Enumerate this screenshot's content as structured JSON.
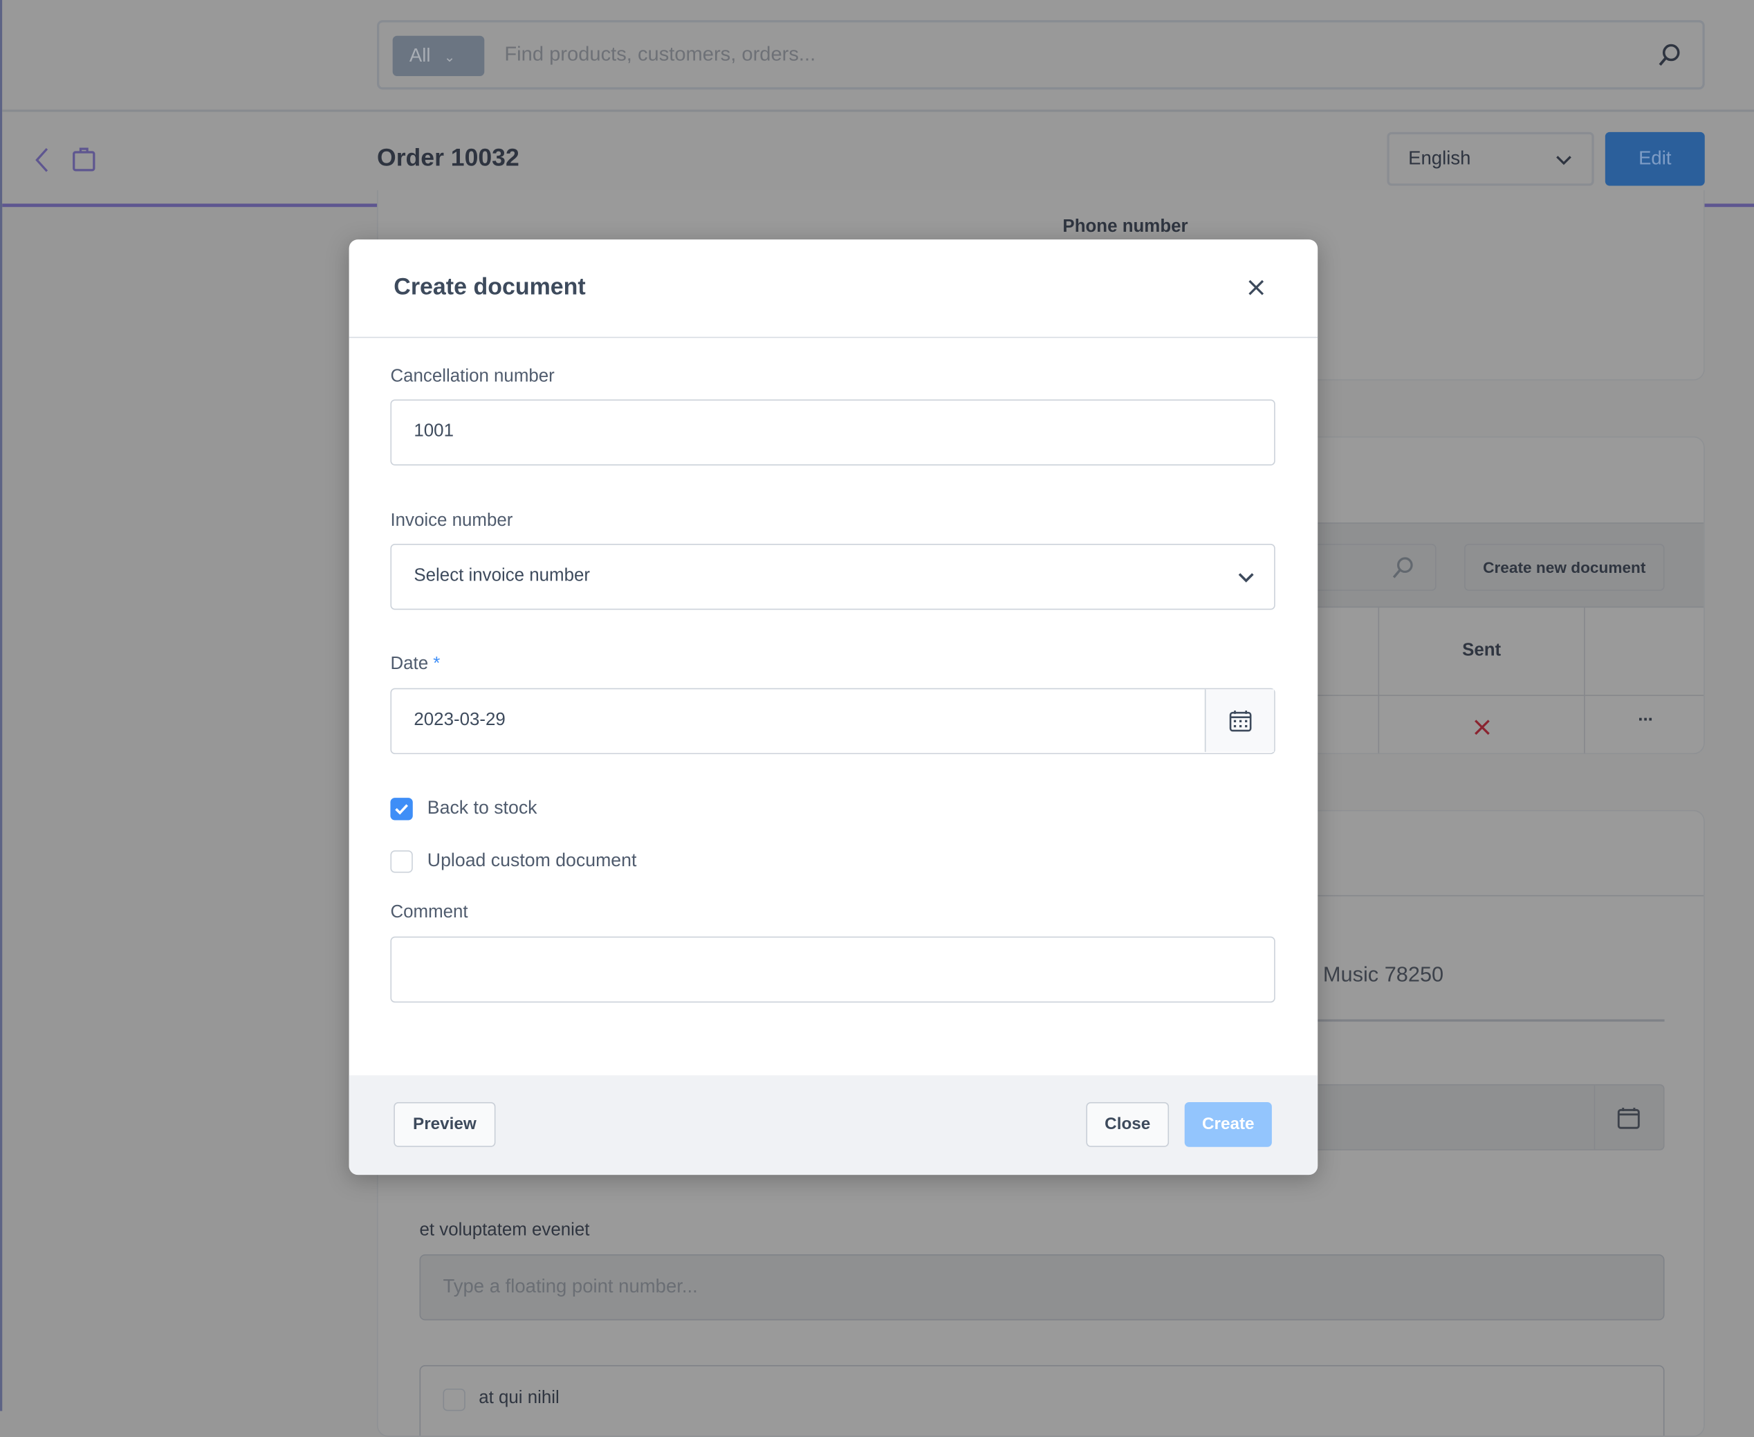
{
  "search": {
    "scope": "All",
    "placeholder": "Find products, customers, orders..."
  },
  "header": {
    "title": "Order 10032",
    "language": "English",
    "edit_label": "Edit"
  },
  "background": {
    "phone_label": "Phone number",
    "create_new_document": "Create new document",
    "sent_header": "Sent",
    "row_more": "...",
    "address_fragment": "c Music 78250",
    "field_label": "et voluptatem eveniet",
    "field_placeholder": "Type a floating point number...",
    "checkbox_label": "at qui nihil"
  },
  "modal": {
    "title": "Create document",
    "cancellation_label": "Cancellation number",
    "cancellation_value": "1001",
    "invoice_label": "Invoice number",
    "invoice_placeholder": "Select invoice number",
    "date_label": "Date",
    "date_required": "*",
    "date_value": "2023-03-29",
    "back_to_stock_label": "Back to stock",
    "back_to_stock_checked": true,
    "upload_label": "Upload custom document",
    "upload_checked": false,
    "comment_label": "Comment",
    "comment_value": "",
    "preview_label": "Preview",
    "close_label": "Close",
    "create_label": "Create"
  },
  "colors": {
    "primary": "#3e8ef7",
    "create_disabled": "#93c5fd",
    "sent_no": "#c0262d",
    "accent_bar": "#5e5690"
  }
}
